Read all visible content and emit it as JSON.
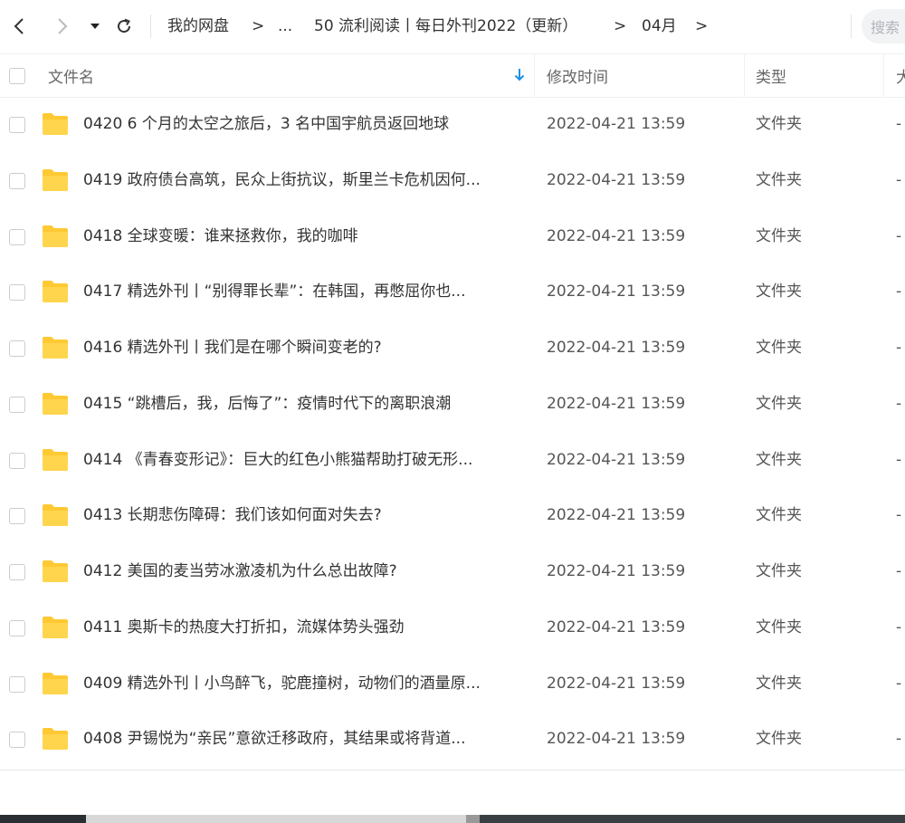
{
  "toolbar": {
    "back_icon": "chevron-left-icon",
    "forward_icon": "chevron-right-icon",
    "history_icon": "caret-down-icon",
    "refresh_icon": "refresh-icon",
    "breadcrumb": [
      "我的网盘",
      "...",
      "50 流利阅读丨每日外刊2022（更新）",
      "04月"
    ],
    "crumb_sep": ">",
    "search_placeholder": "搜索"
  },
  "columns": {
    "name": "文件名",
    "modified": "修改时间",
    "type": "类型",
    "size": "大"
  },
  "sort_icon": "sort-down-arrow-icon",
  "accent_color": "#1e90e6",
  "folder_color": "#ffc933",
  "rows": [
    {
      "name": "0420 6 个月的太空之旅后，3 名中国宇航员返回地球",
      "time": "2022-04-21 13:59",
      "type": "文件夹",
      "size": "-"
    },
    {
      "name": "0419 政府债台高筑，民众上街抗议，斯里兰卡危机因何...",
      "time": "2022-04-21 13:59",
      "type": "文件夹",
      "size": "-"
    },
    {
      "name": "0418 全球变暖：谁来拯救你，我的咖啡",
      "time": "2022-04-21 13:59",
      "type": "文件夹",
      "size": "-"
    },
    {
      "name": "0417 精选外刊丨“别得罪长辈”：在韩国，再憋屈你也...",
      "time": "2022-04-21 13:59",
      "type": "文件夹",
      "size": "-"
    },
    {
      "name": "0416 精选外刊丨我们是在哪个瞬间变老的?",
      "time": "2022-04-21 13:59",
      "type": "文件夹",
      "size": "-"
    },
    {
      "name": "0415 “跳槽后，我，后悔了”：疫情时代下的离职浪潮",
      "time": "2022-04-21 13:59",
      "type": "文件夹",
      "size": "-"
    },
    {
      "name": "0414 《青春变形记》：巨大的红色小熊猫帮助打破无形...",
      "time": "2022-04-21 13:59",
      "type": "文件夹",
      "size": "-"
    },
    {
      "name": "0413 长期悲伤障碍：我们该如何面对失去?",
      "time": "2022-04-21 13:59",
      "type": "文件夹",
      "size": "-"
    },
    {
      "name": "0412 美国的麦当劳冰激凌机为什么总出故障?",
      "time": "2022-04-21 13:59",
      "type": "文件夹",
      "size": "-"
    },
    {
      "name": "0411 奥斯卡的热度大打折扣，流媒体势头强劲",
      "time": "2022-04-21 13:59",
      "type": "文件夹",
      "size": "-"
    },
    {
      "name": "0409 精选外刊丨小鸟醉飞，驼鹿撞树，动物们的酒量原...",
      "time": "2022-04-21 13:59",
      "type": "文件夹",
      "size": "-"
    },
    {
      "name": "0408 尹锡悦为“亲民”意欲迁移政府，其结果或将背道...",
      "time": "2022-04-21 13:59",
      "type": "文件夹",
      "size": "-"
    }
  ]
}
